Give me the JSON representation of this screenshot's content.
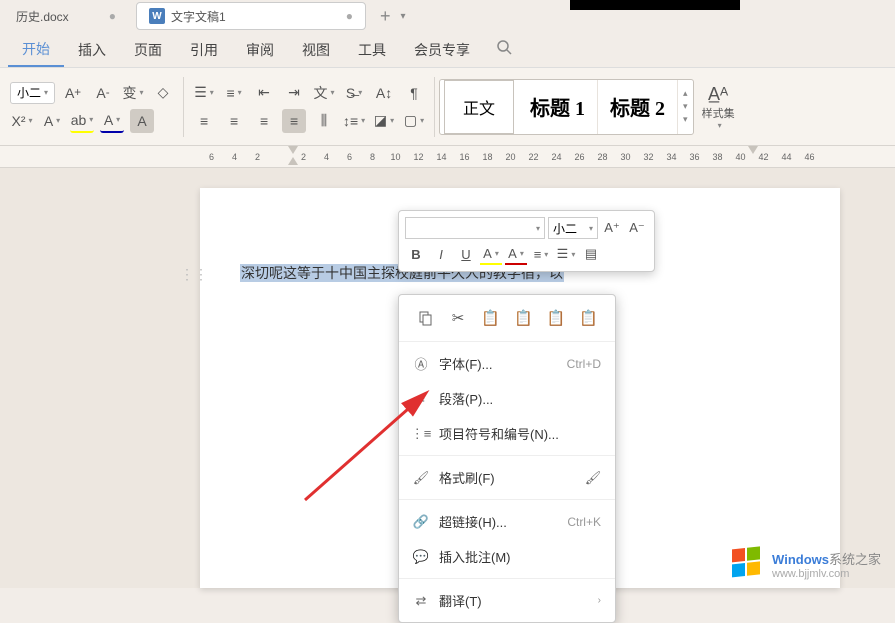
{
  "tabs": {
    "inactive": {
      "label": "历史.docx",
      "close": "●"
    },
    "active": {
      "icon": "W",
      "label": "文字文稿1",
      "close": "●"
    },
    "add": "+",
    "menu": "▾"
  },
  "menubar": {
    "items": [
      "开始",
      "插入",
      "页面",
      "引用",
      "审阅",
      "视图",
      "工具",
      "会员专享"
    ],
    "active_index": 0
  },
  "toolbar": {
    "font_size": "小二",
    "styles": {
      "normal": "正文",
      "heading1": "标题 1",
      "heading2": "标题 2"
    },
    "styleset_label": "样式集"
  },
  "ruler": {
    "ticks": [
      "6",
      "4",
      "2",
      "",
      "2",
      "4",
      "6",
      "8",
      "10",
      "12",
      "14",
      "16",
      "18",
      "20",
      "22",
      "24",
      "26",
      "28",
      "30",
      "32",
      "34",
      "36",
      "38",
      "40",
      "42",
      "44",
      "46"
    ]
  },
  "document": {
    "selected_line1": "深切呢这等于十中国主探校庭前平久人的教学宿，以"
  },
  "mini_toolbar": {
    "font_name": "",
    "font_size": "小二"
  },
  "context_menu": {
    "font": {
      "label": "字体(F)...",
      "shortcut": "Ctrl+D"
    },
    "paragraph": {
      "label": "段落(P)..."
    },
    "bullets": {
      "label": "项目符号和编号(N)..."
    },
    "format_painter": {
      "label": "格式刷(F)"
    },
    "hyperlink": {
      "label": "超链接(H)...",
      "shortcut": "Ctrl+K"
    },
    "comment": {
      "label": "插入批注(M)"
    },
    "translate": {
      "label": "翻译(T)"
    }
  },
  "watermark": {
    "title_blue": "Windows",
    "title_gray": "系统之家",
    "url": "www.bjjmlv.com"
  }
}
